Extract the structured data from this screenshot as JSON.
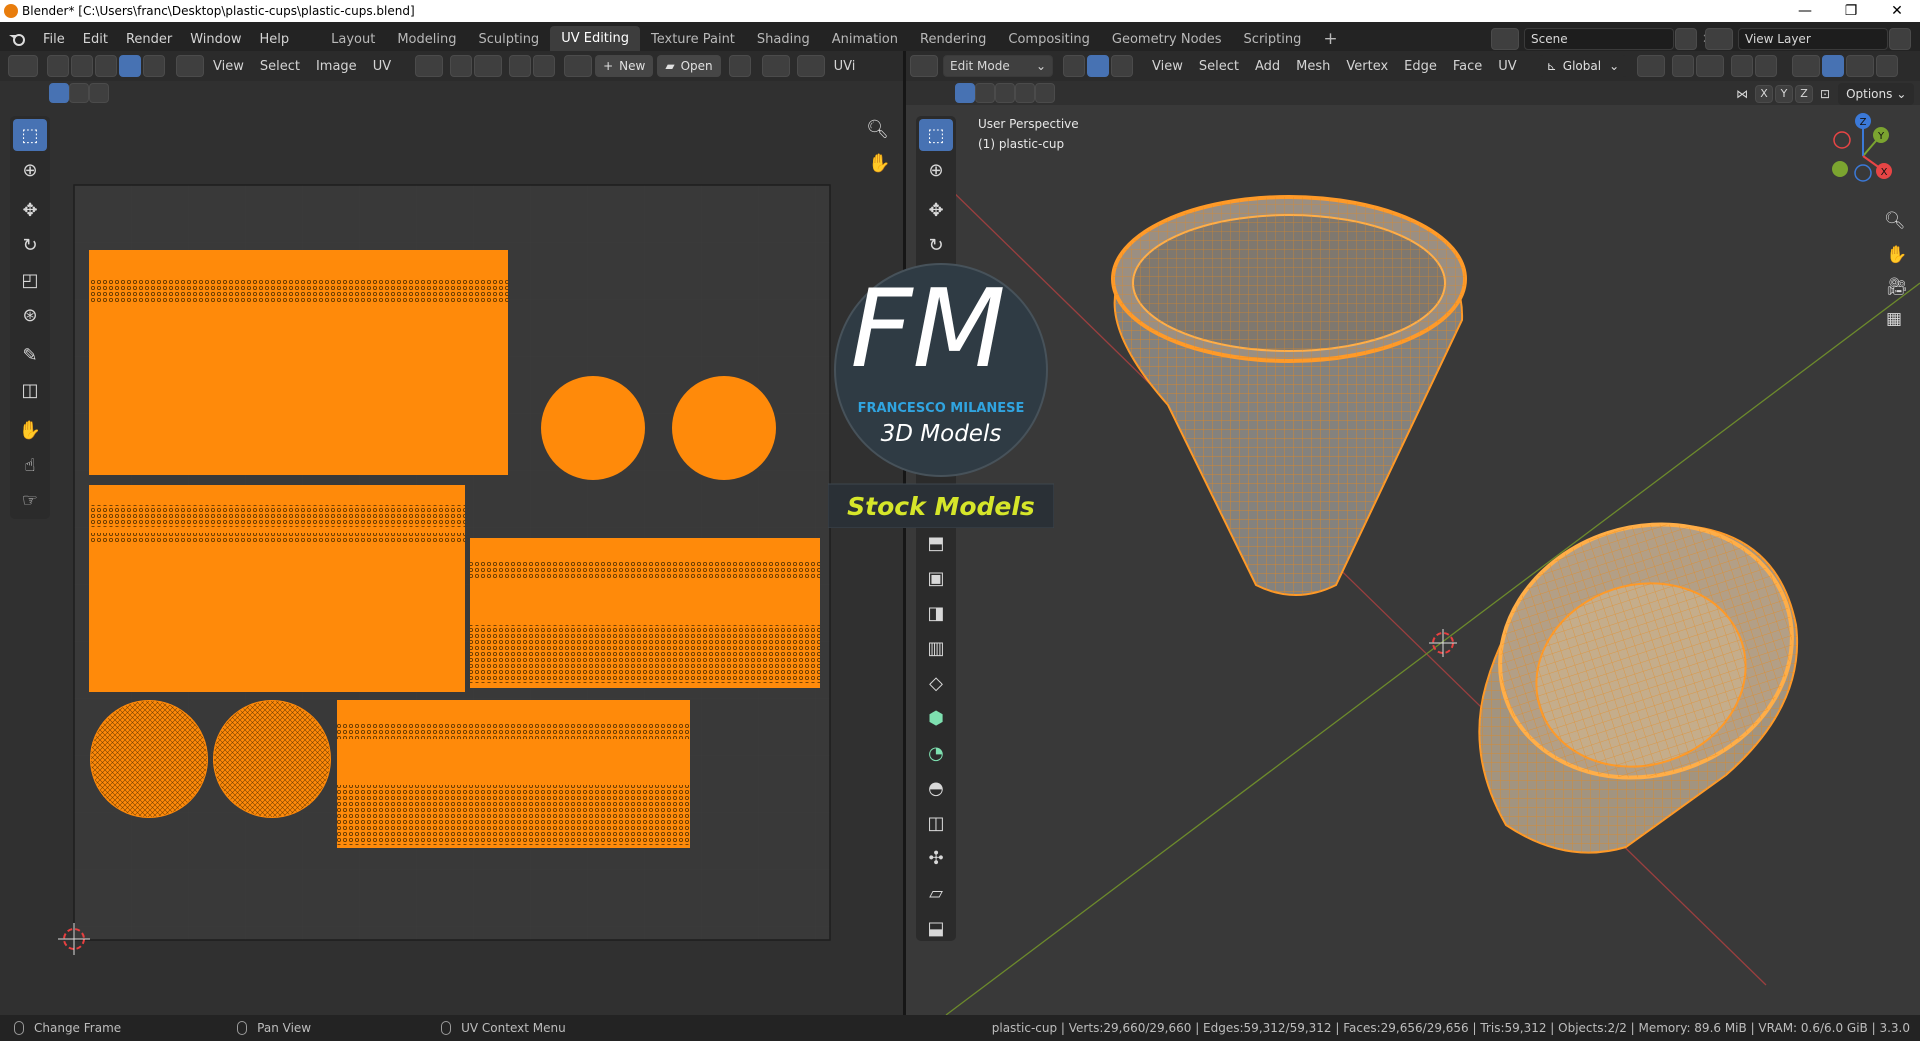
{
  "window": {
    "title": "Blender* [C:\\Users\\franc\\Desktop\\plastic-cups\\plastic-cups.blend]",
    "minimize": "—",
    "maximize": "❐",
    "close": "✕"
  },
  "menu": [
    "File",
    "Edit",
    "Render",
    "Window",
    "Help"
  ],
  "workspaces": [
    "Layout",
    "Modeling",
    "Sculpting",
    "UV Editing",
    "Texture Paint",
    "Shading",
    "Animation",
    "Rendering",
    "Compositing",
    "Geometry Nodes",
    "Scripting"
  ],
  "workspace_add": "+",
  "scene": {
    "label": "Scene",
    "view_layer": "View Layer"
  },
  "uv_editor": {
    "menus": [
      "View",
      "Select",
      "Image",
      "UV"
    ],
    "new_label": "New",
    "open_label": "Open",
    "uv_tag": "UVi"
  },
  "viewport": {
    "mode": "Edit Mode",
    "menus": [
      "View",
      "Select",
      "Add",
      "Mesh",
      "Vertex",
      "Edge",
      "Face",
      "UV"
    ],
    "transform": "Global",
    "options": "Options",
    "axes": [
      "X",
      "Y",
      "Z"
    ],
    "perspective": "User Perspective",
    "object": "(1) plastic-cup",
    "gizmo": {
      "x": "X",
      "y": "Y",
      "z": "Z"
    }
  },
  "watermark": {
    "logo": "FM",
    "name": "FRANCESCO MILANESE",
    "subtitle": "3D Models",
    "banner": "Stock Models"
  },
  "status": {
    "left": "Change Frame",
    "middle": "Pan View",
    "right": "UV Context Menu",
    "stats": "plastic-cup | Verts:29,660/29,660 | Edges:59,312/59,312 | Faces:29,656/29,656 | Tris:59,312 | Objects:2/2 | Memory: 89.6 MiB | VRAM: 0.6/6.0 GiB | 3.3.0"
  },
  "colors": {
    "accent": "#4772b3",
    "uv_orange": "#ff8a0a",
    "wire": "#ffa632"
  }
}
